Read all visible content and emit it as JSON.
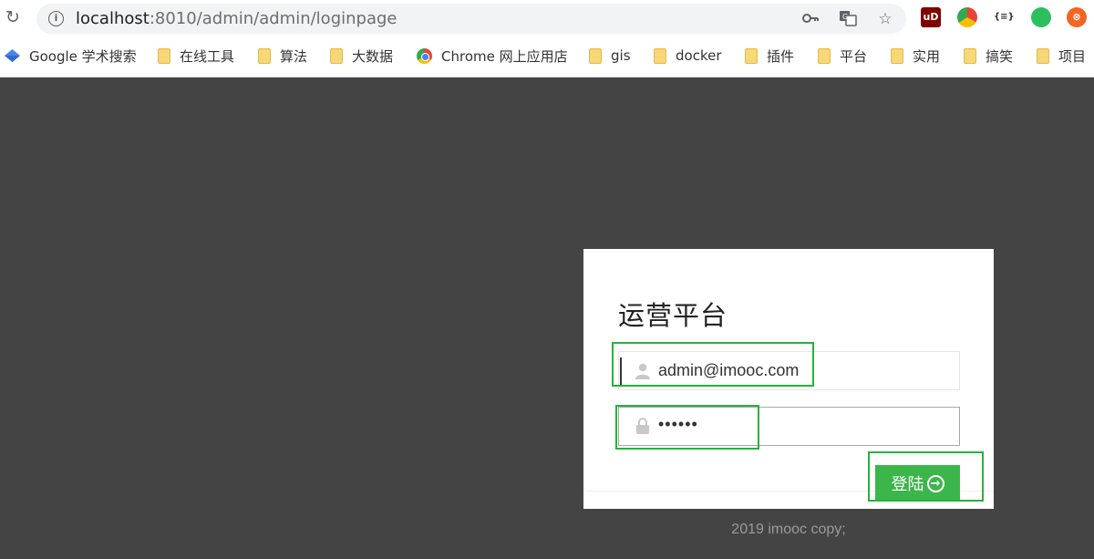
{
  "browser": {
    "url_host": "localhost",
    "url_rest": ":8010/admin/admin/loginpage",
    "reload_icon": "reload-icon",
    "info_icon": "info-icon",
    "info_glyph": "i",
    "key_icon": "key-icon",
    "translate_icon": "translate-icon",
    "star_icon": "star-icon",
    "extensions": [
      {
        "name": "ublock-icon",
        "glyph": "uD",
        "bg": "#800000",
        "fg": "#ffffff"
      },
      {
        "name": "chrome-colors-icon",
        "glyph": "",
        "bg": "#f4b400",
        "fg": "#ffffff"
      },
      {
        "name": "json-viewer-icon",
        "glyph": "{≡}",
        "bg": "#ffffff",
        "fg": "#333333"
      },
      {
        "name": "evernote-icon",
        "glyph": "",
        "bg": "#2dbe60",
        "fg": "#ffffff"
      },
      {
        "name": "share-extension-icon",
        "glyph": "",
        "bg": "#f26522",
        "fg": "#ffffff"
      }
    ]
  },
  "bookmarks": [
    {
      "label": "Google 学术搜索",
      "icon": "scholar-icon"
    },
    {
      "label": "在线工具",
      "icon": "folder-icon"
    },
    {
      "label": "算法",
      "icon": "folder-icon"
    },
    {
      "label": "大数据",
      "icon": "folder-icon"
    },
    {
      "label": "Chrome 网上应用店",
      "icon": "chrome-store-icon"
    },
    {
      "label": "gis",
      "icon": "folder-icon"
    },
    {
      "label": "docker",
      "icon": "folder-icon"
    },
    {
      "label": "插件",
      "icon": "folder-icon"
    },
    {
      "label": "平台",
      "icon": "folder-icon"
    },
    {
      "label": "实用",
      "icon": "folder-icon"
    },
    {
      "label": "搞笑",
      "icon": "folder-icon"
    },
    {
      "label": "项目",
      "icon": "folder-icon"
    }
  ],
  "login": {
    "title": "运营平台",
    "username_value": "admin@imooc.com",
    "username_icon": "user-icon",
    "password_value": "••••••",
    "password_icon": "lock-icon",
    "submit_label": "登陆",
    "submit_icon": "arrow-circle-right-icon",
    "submit_glyph": "→"
  },
  "footer": {
    "copyright": "2019 imooc copy;"
  },
  "colors": {
    "page_bg": "#444444",
    "button": "#3cb54a",
    "highlight": "#27b33e"
  }
}
